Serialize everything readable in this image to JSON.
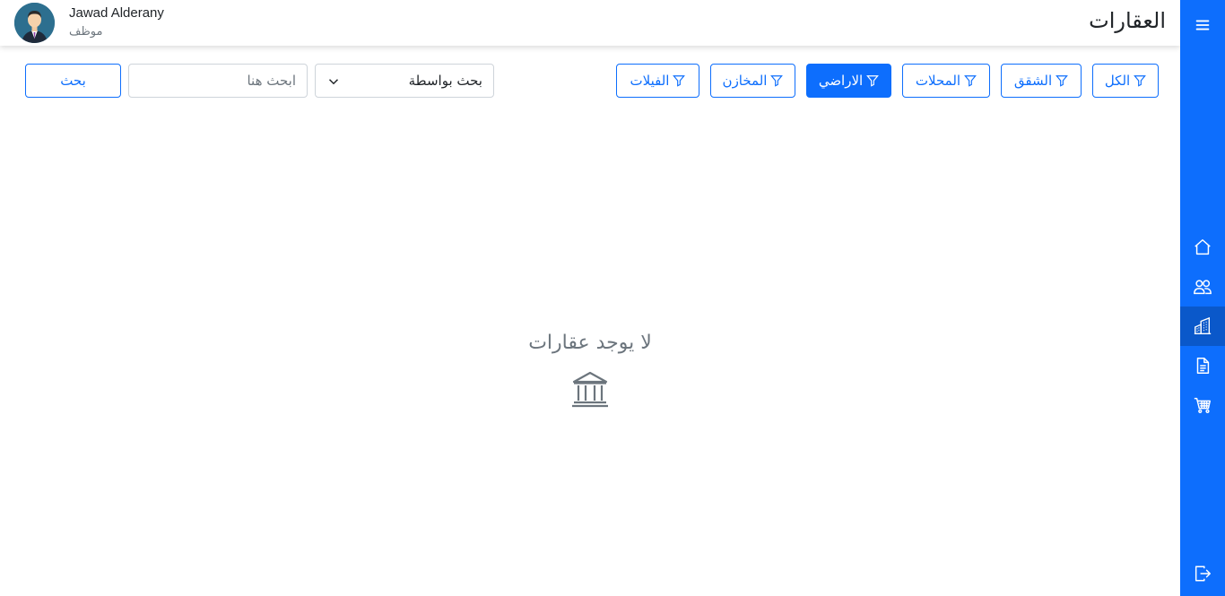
{
  "header": {
    "title": "العقارات",
    "user_name": "Jawad Alderany",
    "user_role": "موظف"
  },
  "filters": [
    {
      "label": "الكل",
      "active": false
    },
    {
      "label": "الشقق",
      "active": false
    },
    {
      "label": "المحلات",
      "active": false
    },
    {
      "label": "الاراضي",
      "active": true
    },
    {
      "label": "المخازن",
      "active": false
    },
    {
      "label": "الفيلات",
      "active": false
    }
  ],
  "search": {
    "by_label": "بحث بواسطة",
    "placeholder": "ابحث هنا",
    "value": "",
    "button_label": "بحث"
  },
  "empty_state": {
    "message": "لا يوجد عقارات",
    "icon": "bank-icon"
  },
  "sidebar": {
    "items": [
      {
        "icon": "menu-icon"
      },
      {
        "icon": "home-icon"
      },
      {
        "icon": "people-icon"
      },
      {
        "icon": "buildings-icon",
        "active": true
      },
      {
        "icon": "document-icon"
      },
      {
        "icon": "cart-icon"
      },
      {
        "icon": "logout-icon"
      }
    ]
  },
  "colors": {
    "primary": "#0d6efd",
    "sidebar_active": "#0a58ca",
    "muted": "#6c757d"
  }
}
